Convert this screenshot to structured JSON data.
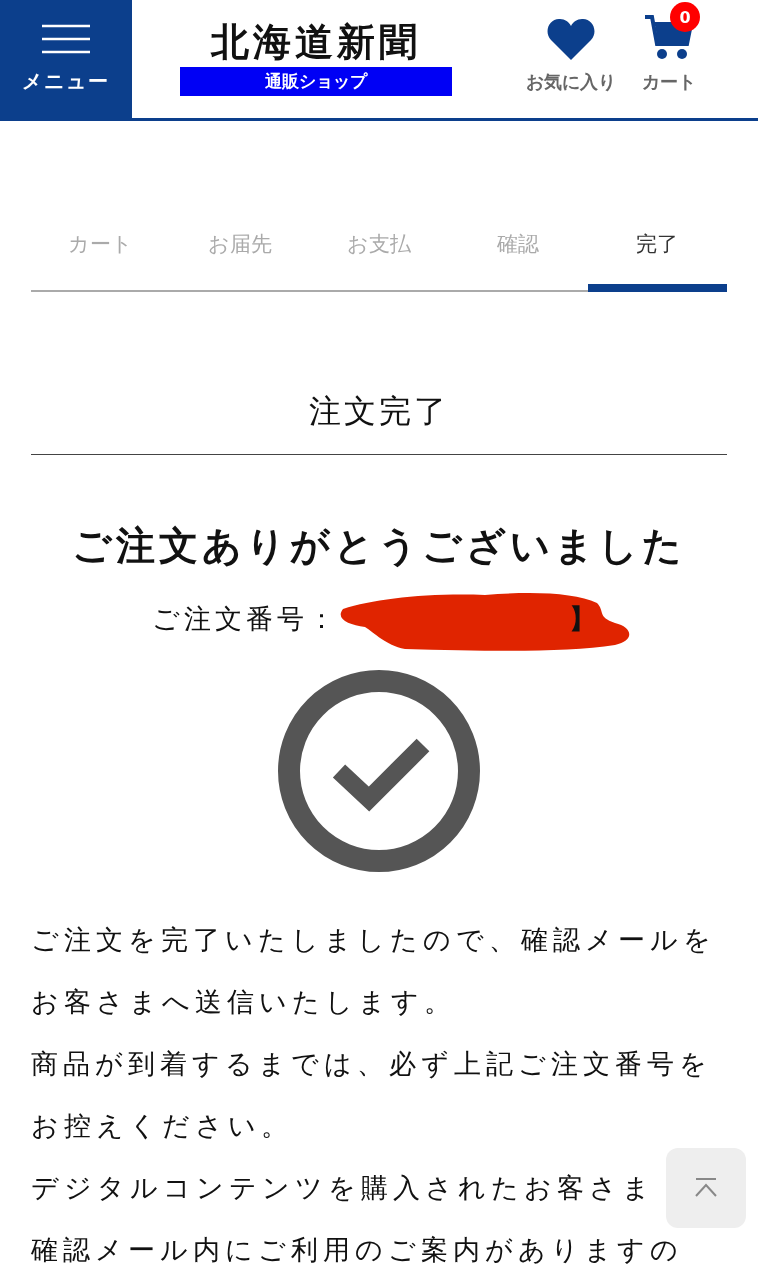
{
  "header": {
    "menu_label": "メニュー",
    "logo_title": "北海道新聞",
    "logo_subtitle": "通販ショップ",
    "favorites_label": "お気に入り",
    "cart_label": "カート",
    "cart_count": "0"
  },
  "steps": [
    {
      "label": "カート",
      "selected": false
    },
    {
      "label": "お届先",
      "selected": false
    },
    {
      "label": "お支払",
      "selected": false
    },
    {
      "label": "確認",
      "selected": false
    },
    {
      "label": "完了",
      "selected": true
    }
  ],
  "page_title": "注文完了",
  "thanks_heading": "ご注文ありがとうございました",
  "order_number": {
    "label": "ご注文番号：",
    "tail": "】"
  },
  "message_lines": [
    "ご注文を完了いたしましたので、確認メールを",
    "お客さまへ送信いたします。",
    "商品が到着するまでは、必ず上記ご注文番号を",
    "お控えください。",
    "デジタルコンテンツを購入されたお客さま",
    "確認メール内にご利用のご案内がありますの"
  ]
}
